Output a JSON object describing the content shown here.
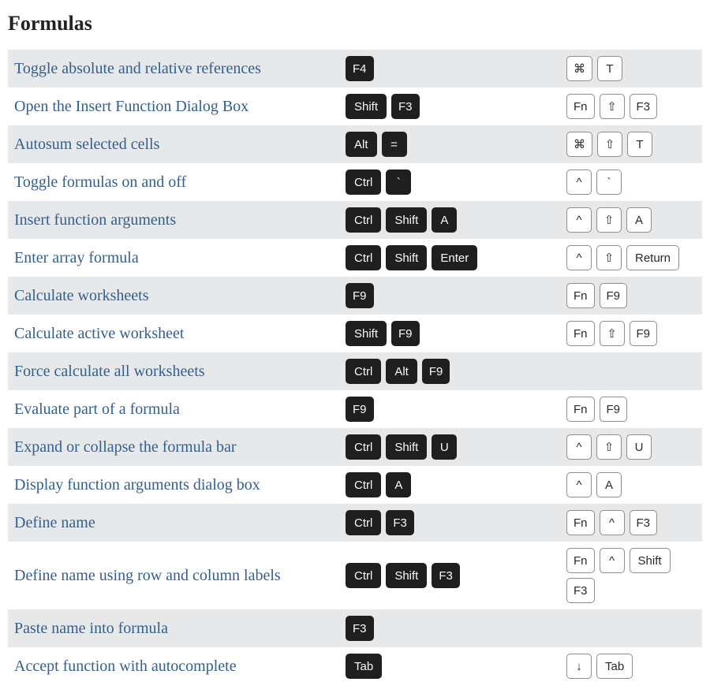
{
  "section_title": "Formulas",
  "rows": [
    {
      "desc": "Toggle absolute and relative references",
      "win": [
        "F4"
      ],
      "mac": [
        "⌘",
        "T"
      ]
    },
    {
      "desc": "Open the Insert Function Dialog Box",
      "win": [
        "Shift",
        "F3"
      ],
      "mac": [
        "Fn",
        "⇧",
        "F3"
      ]
    },
    {
      "desc": "Autosum selected cells",
      "win": [
        "Alt",
        "="
      ],
      "mac": [
        "⌘",
        "⇧",
        "T"
      ]
    },
    {
      "desc": "Toggle formulas on and off",
      "win": [
        "Ctrl",
        "`"
      ],
      "mac": [
        "^",
        "`"
      ]
    },
    {
      "desc": "Insert function arguments",
      "win": [
        "Ctrl",
        "Shift",
        "A"
      ],
      "mac": [
        "^",
        "⇧",
        "A"
      ]
    },
    {
      "desc": "Enter array formula",
      "win": [
        "Ctrl",
        "Shift",
        "Enter"
      ],
      "mac": [
        "^",
        "⇧",
        "Return"
      ]
    },
    {
      "desc": "Calculate worksheets",
      "win": [
        "F9"
      ],
      "mac": [
        "Fn",
        "F9"
      ]
    },
    {
      "desc": "Calculate active worksheet",
      "win": [
        "Shift",
        "F9"
      ],
      "mac": [
        "Fn",
        "⇧",
        "F9"
      ]
    },
    {
      "desc": "Force calculate all worksheets",
      "win": [
        "Ctrl",
        "Alt",
        "F9"
      ],
      "mac": []
    },
    {
      "desc": "Evaluate part of a formula",
      "win": [
        "F9"
      ],
      "mac": [
        "Fn",
        "F9"
      ]
    },
    {
      "desc": "Expand or collapse the formula bar",
      "win": [
        "Ctrl",
        "Shift",
        "U"
      ],
      "mac": [
        "^",
        "⇧",
        "U"
      ]
    },
    {
      "desc": "Display function arguments dialog box",
      "win": [
        "Ctrl",
        "A"
      ],
      "mac": [
        "^",
        "A"
      ]
    },
    {
      "desc": "Define name",
      "win": [
        "Ctrl",
        "F3"
      ],
      "mac": [
        "Fn",
        "^",
        "F3"
      ]
    },
    {
      "desc": "Define name using row and column labels",
      "win": [
        "Ctrl",
        "Shift",
        "F3"
      ],
      "mac": [
        "Fn",
        "^",
        "Shift",
        "F3"
      ]
    },
    {
      "desc": "Paste name into formula",
      "win": [
        "F3"
      ],
      "mac": []
    },
    {
      "desc": "Accept function with autocomplete",
      "win": [
        "Tab"
      ],
      "mac": [
        "↓",
        "Tab"
      ]
    }
  ]
}
